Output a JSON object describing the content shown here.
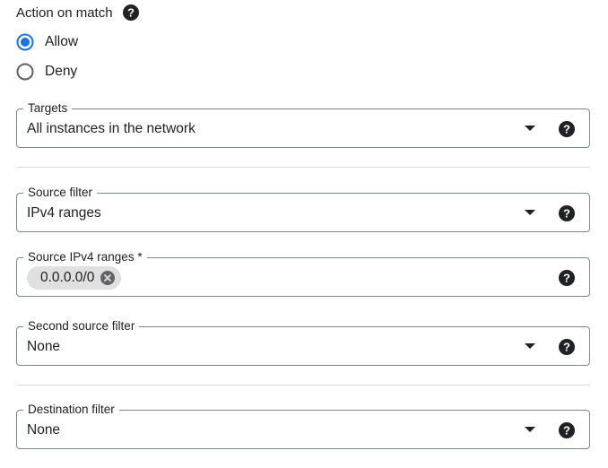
{
  "action_on_match": {
    "title": "Action on match",
    "options": [
      {
        "label": "Allow",
        "selected": true
      },
      {
        "label": "Deny",
        "selected": false
      }
    ]
  },
  "targets": {
    "label": "Targets",
    "value": "All instances in the network"
  },
  "source_filter": {
    "label": "Source filter",
    "value": "IPv4 ranges"
  },
  "source_ipv4_ranges": {
    "label": "Source IPv4 ranges *",
    "chips": [
      "0.0.0.0/0"
    ]
  },
  "second_source_filter": {
    "label": "Second source filter",
    "value": "None"
  },
  "destination_filter": {
    "label": "Destination filter",
    "value": "None"
  },
  "colors": {
    "accent": "#1a73e8",
    "text": "#202124",
    "border": "#80868b",
    "divider": "#dadce0",
    "chip_bg": "#e0e0e0"
  },
  "icons": {
    "help": "help-circle-icon",
    "dropdown": "arrow-drop-down-icon",
    "chip_remove": "cancel-icon",
    "radio_checked": "radio-checked-icon",
    "radio_unchecked": "radio-unchecked-icon"
  }
}
